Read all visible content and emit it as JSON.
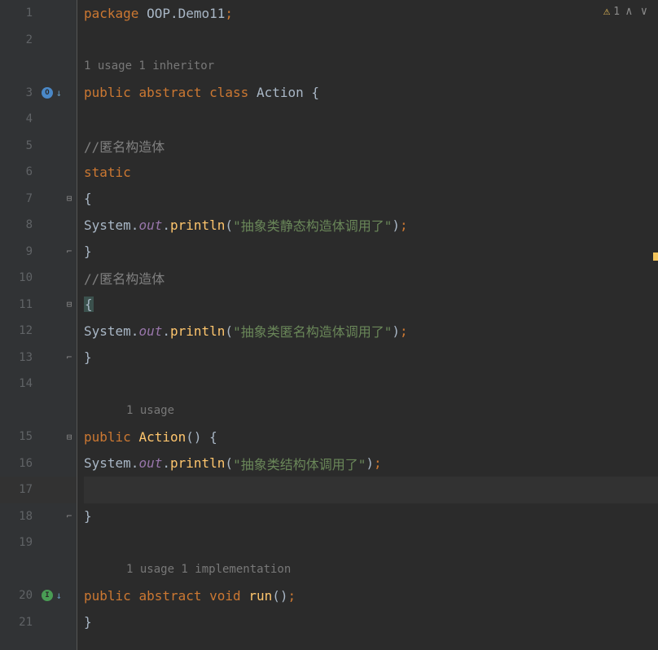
{
  "inspection": {
    "count": "1"
  },
  "hints": {
    "h1": "1 usage   1 inheritor",
    "h2": "1 usage",
    "h3": "1 usage   1 implementation"
  },
  "lines": {
    "l1_package": "package",
    "l1_pkg": " OOP.Demo11",
    "l1_semi": ";",
    "l3_public": "public",
    "l3_abstract": "abstract",
    "l3_class": "class",
    "l3_name": "Action",
    "l3_brace": " {",
    "l5_comment": "//匿名构造体",
    "l6_static": "static",
    "l7_brace": "{",
    "l8_sys": "System.",
    "l8_out": "out",
    "l8_dot": ".",
    "l8_println": "println",
    "l8_open": "(",
    "l8_str": "\"抽象类静态构造体调用了\"",
    "l8_close": ")",
    "l8_semi": ";",
    "l9_brace": "}",
    "l10_comment": "//匿名构造体",
    "l11_brace": "{",
    "l12_sys": "System.",
    "l12_out": "out",
    "l12_dot": ".",
    "l12_println": "println",
    "l12_open": "(",
    "l12_str": "\"抽象类匿名构造体调用了\"",
    "l12_close": ")",
    "l12_semi": ";",
    "l13_brace": "}",
    "l15_public": "public",
    "l15_name": "Action",
    "l15_parens": "() {",
    "l16_sys": "System.",
    "l16_out": "out",
    "l16_dot": ".",
    "l16_println": "println",
    "l16_open": "(",
    "l16_str": "\"抽象类结构体调用了\"",
    "l16_close": ")",
    "l16_semi": ";",
    "l18_brace": "}",
    "l20_public": "public",
    "l20_abstract": "abstract",
    "l20_void": "void",
    "l20_run": "run",
    "l20_parens": "()",
    "l20_semi": ";",
    "l21_brace": "}"
  },
  "lineNumbers": {
    "n1": "1",
    "n2": "2",
    "n3": "3",
    "n4": "4",
    "n5": "5",
    "n6": "6",
    "n7": "7",
    "n8": "8",
    "n9": "9",
    "n10": "10",
    "n11": "11",
    "n12": "12",
    "n13": "13",
    "n14": "14",
    "n15": "15",
    "n16": "16",
    "n17": "17",
    "n18": "18",
    "n19": "19",
    "n20": "20",
    "n21": "21"
  }
}
